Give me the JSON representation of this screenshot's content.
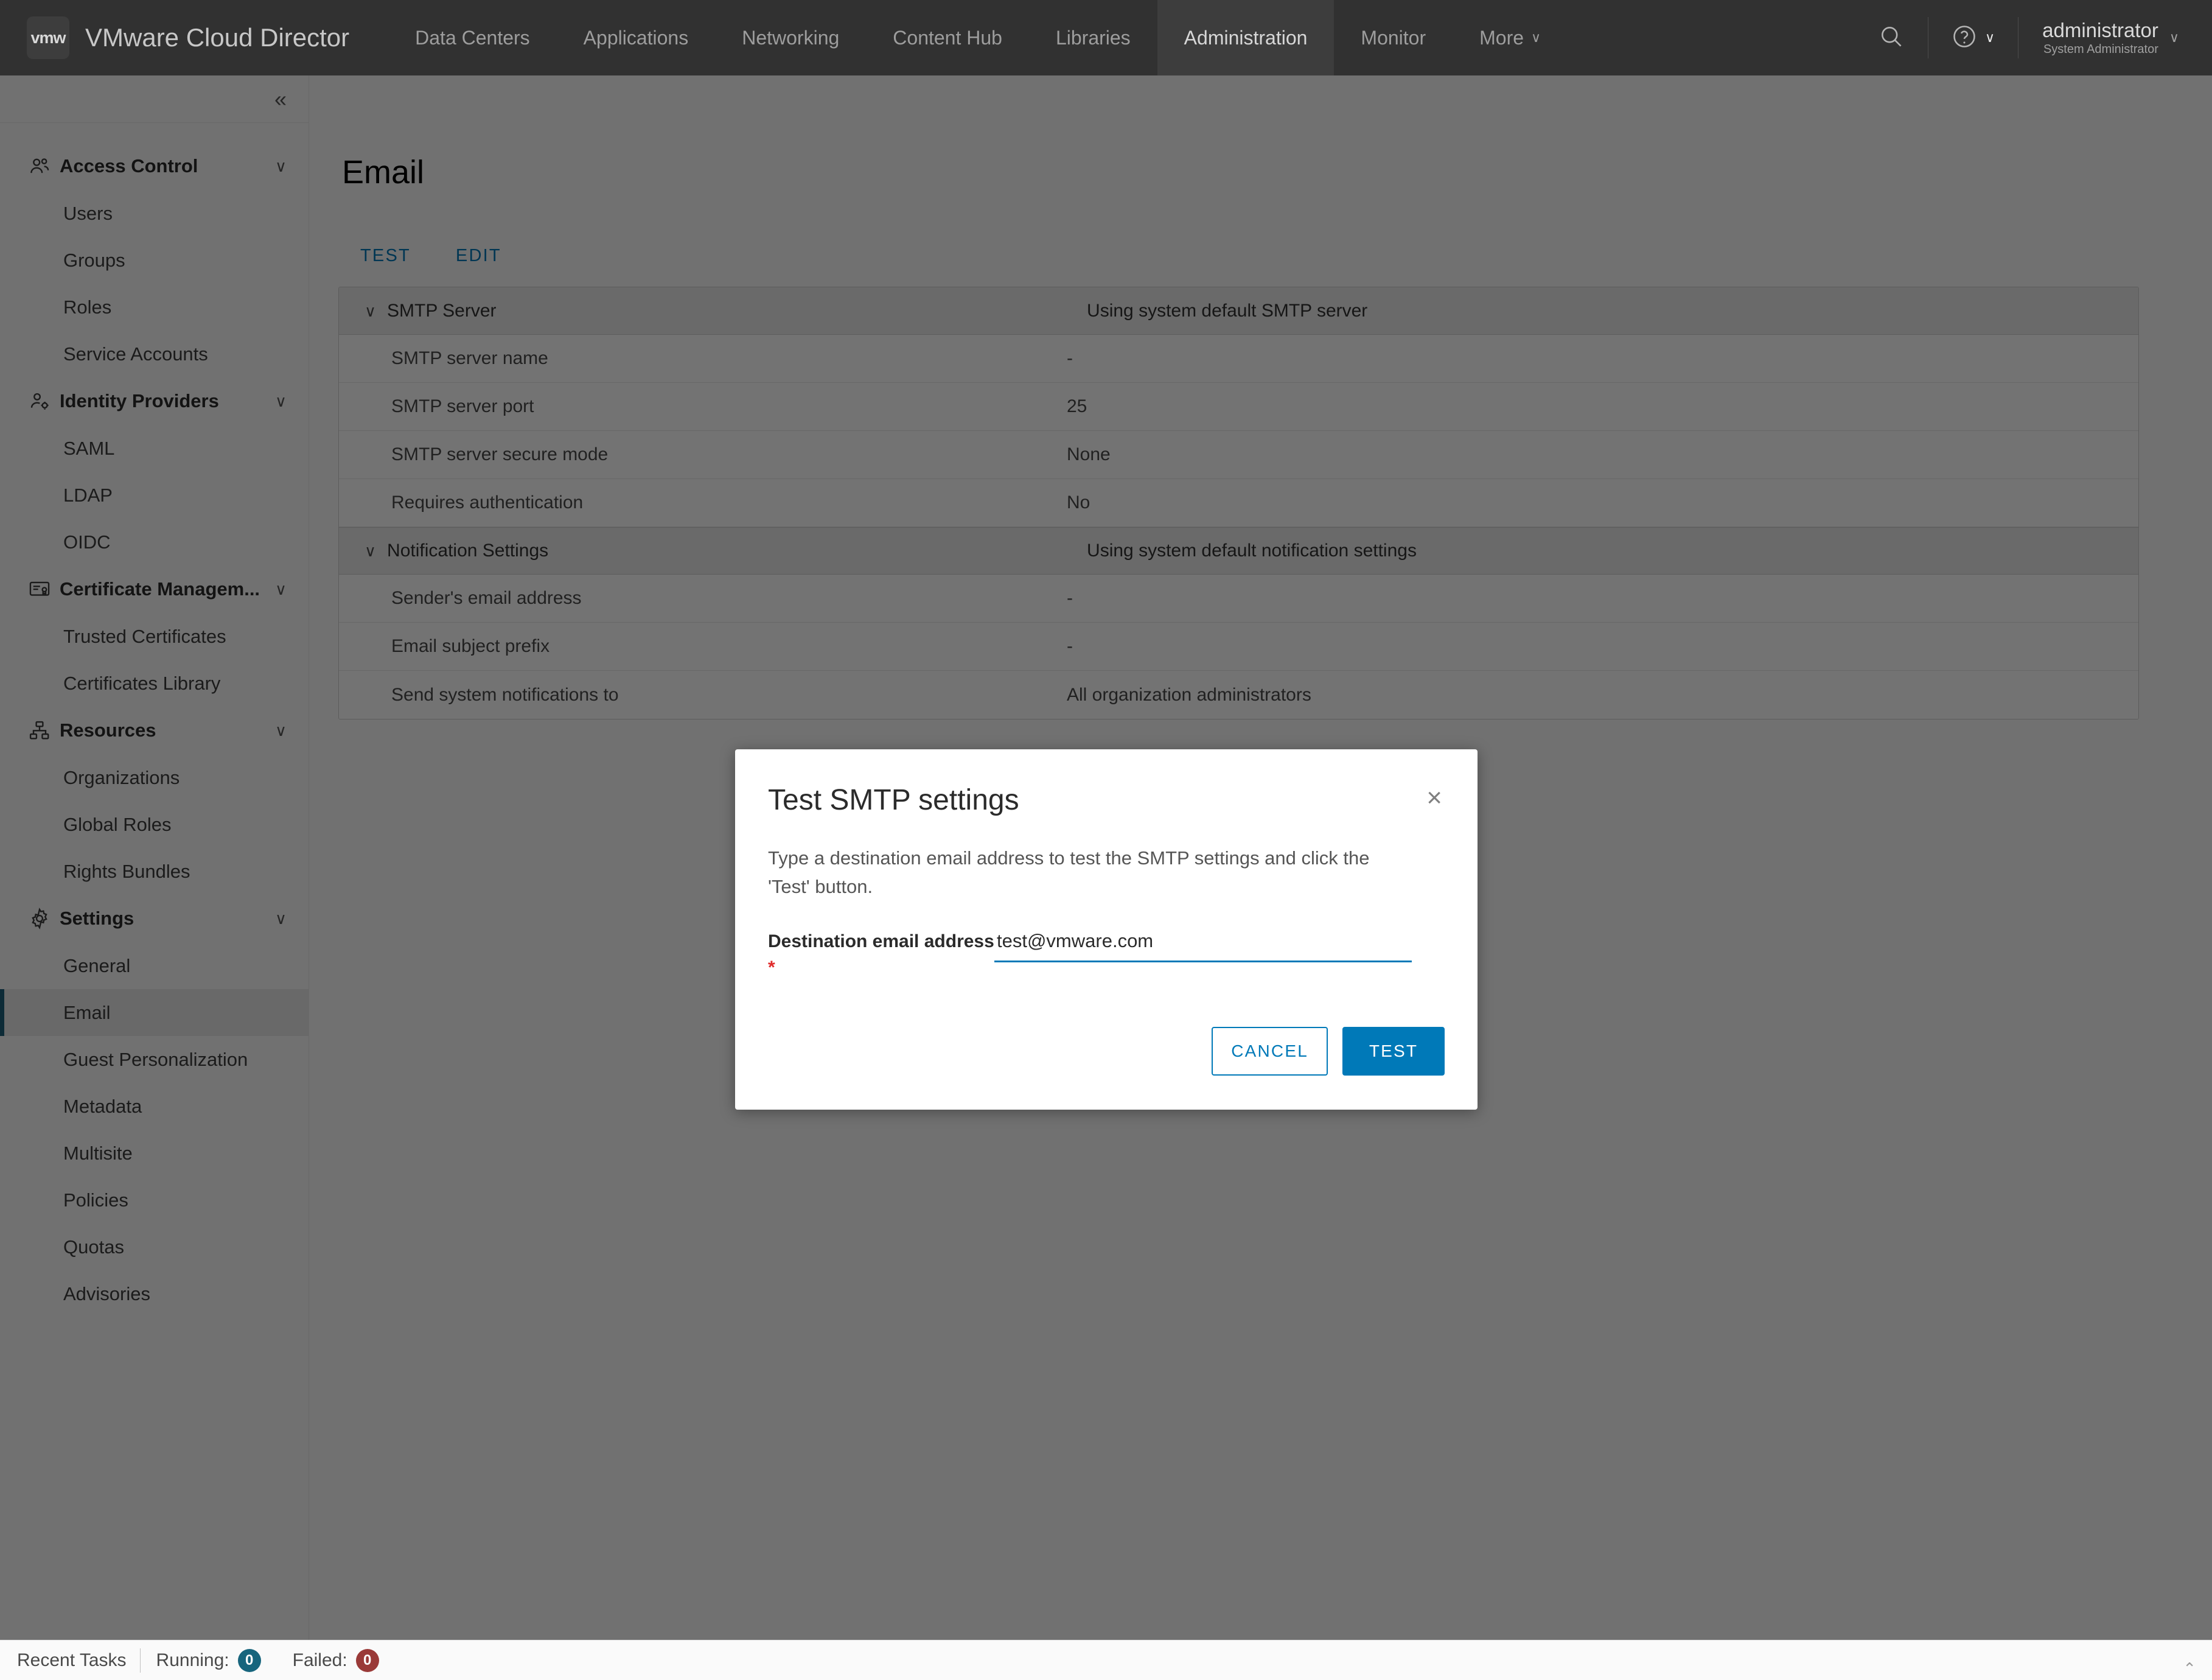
{
  "header": {
    "logo_text": "vmw",
    "product_title": "VMware Cloud Director",
    "nav_items": [
      {
        "label": "Data Centers",
        "active": false
      },
      {
        "label": "Applications",
        "active": false
      },
      {
        "label": "Networking",
        "active": false
      },
      {
        "label": "Content Hub",
        "active": false
      },
      {
        "label": "Libraries",
        "active": false
      },
      {
        "label": "Administration",
        "active": true
      },
      {
        "label": "Monitor",
        "active": false
      }
    ],
    "more_label": "More",
    "more_caret": "∨",
    "search_icon": "search-icon",
    "help_icon": "help-icon",
    "help_caret": "∨",
    "user_name": "administrator",
    "user_role": "System Administrator",
    "user_caret": "∨"
  },
  "sidebar": {
    "collapse_icon": "«",
    "groups": [
      {
        "label": "Access Control",
        "icon": "users-icon",
        "caret": "∨",
        "children": [
          {
            "label": "Users",
            "selected": false
          },
          {
            "label": "Groups",
            "selected": false
          },
          {
            "label": "Roles",
            "selected": false
          },
          {
            "label": "Service Accounts",
            "selected": false
          }
        ]
      },
      {
        "label": "Identity Providers",
        "icon": "user-gear-icon",
        "caret": "∨",
        "children": [
          {
            "label": "SAML",
            "selected": false
          },
          {
            "label": "LDAP",
            "selected": false
          },
          {
            "label": "OIDC",
            "selected": false
          }
        ]
      },
      {
        "label": "Certificate Managem...",
        "icon": "certificate-icon",
        "caret": "∨",
        "children": [
          {
            "label": "Trusted Certificates",
            "selected": false
          },
          {
            "label": "Certificates Library",
            "selected": false
          }
        ]
      },
      {
        "label": "Resources",
        "icon": "resources-icon",
        "caret": "∨",
        "children": [
          {
            "label": "Organizations",
            "selected": false
          },
          {
            "label": "Global Roles",
            "selected": false
          },
          {
            "label": "Rights Bundles",
            "selected": false
          }
        ]
      },
      {
        "label": "Settings",
        "icon": "gear-icon",
        "caret": "∨",
        "children": [
          {
            "label": "General",
            "selected": false
          },
          {
            "label": "Email",
            "selected": true
          },
          {
            "label": "Guest Personalization",
            "selected": false
          },
          {
            "label": "Metadata",
            "selected": false
          },
          {
            "label": "Multisite",
            "selected": false
          },
          {
            "label": "Policies",
            "selected": false
          },
          {
            "label": "Quotas",
            "selected": false
          },
          {
            "label": "Advisories",
            "selected": false
          }
        ]
      }
    ]
  },
  "main": {
    "page_title": "Email",
    "tabs": [
      {
        "label": "TEST"
      },
      {
        "label": "EDIT"
      }
    ],
    "sections": [
      {
        "caret": "∨",
        "title": "SMTP Server",
        "summary": "Using system default SMTP server",
        "rows": [
          {
            "label": "SMTP server name",
            "value": "-"
          },
          {
            "label": "SMTP server port",
            "value": "25"
          },
          {
            "label": "SMTP server secure mode",
            "value": "None"
          },
          {
            "label": "Requires authentication",
            "value": "No"
          }
        ]
      },
      {
        "caret": "∨",
        "title": "Notification Settings",
        "summary": "Using system default notification settings",
        "rows": [
          {
            "label": "Sender's email address",
            "value": "-"
          },
          {
            "label": "Email subject prefix",
            "value": "-"
          },
          {
            "label": "Send system notifications to",
            "value": "All organization administrators"
          }
        ]
      }
    ]
  },
  "modal": {
    "title": "Test SMTP settings",
    "close_icon": "×",
    "description": "Type a destination email address to test the SMTP settings and click the 'Test' button.",
    "field_label": "Destination email address",
    "required_marker": "*",
    "field_value": "test@vmware.com",
    "field_placeholder": "",
    "cancel_label": "CANCEL",
    "test_label": "TEST"
  },
  "footer": {
    "recent_tasks_label": "Recent Tasks",
    "running_label": "Running:",
    "running_count": "0",
    "failed_label": "Failed:",
    "failed_count": "0",
    "resize_handle": "⌃"
  },
  "colors": {
    "accent": "#0079b8",
    "header_bg": "#313131",
    "selected_nav": "#1d5f7a",
    "required": "#e02b2b",
    "badge_running": "#17657d",
    "badge_failed": "#9a3a38"
  }
}
